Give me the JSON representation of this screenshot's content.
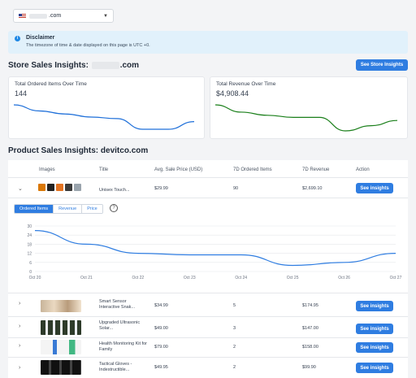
{
  "store_selector": {
    "domain_suffix": ".com",
    "icon": "flag-icon"
  },
  "disclaimer": {
    "title": "Disclaimer",
    "text": "The timezone of time & date displayed on this page is UTC +0."
  },
  "store_insights": {
    "title": "Store Sales Insights:",
    "domain_suffix": ".com",
    "button_label": "See Store Insights",
    "ordered_items": {
      "title": "Total Ordered Items Over Time",
      "value": "144"
    },
    "revenue": {
      "title": "Total Revenue Over Time",
      "value": "$4,908.44"
    }
  },
  "product_insights": {
    "title": "Product Sales Insights: devitco.com",
    "columns": [
      "Images",
      "Title",
      "Avg. Sale Price (USD)",
      "7D Ordered Items",
      "7D Revenue",
      "Action"
    ],
    "rows": [
      {
        "title": "Unisex Touch...",
        "price": "$29.99",
        "ordered": "90",
        "revenue": "$2,699.10",
        "action": "See insights"
      },
      {
        "title": "Smart Sensor Interactive Snak...",
        "price": "$34.99",
        "ordered": "5",
        "revenue": "$174.95",
        "action": "See insights"
      },
      {
        "title": "Upgraded Ultrasonic Solar...",
        "price": "$49.00",
        "ordered": "3",
        "revenue": "$147.00",
        "action": "See insights"
      },
      {
        "title": "Health Monitoring Kit for Family",
        "price": "$79.00",
        "ordered": "2",
        "revenue": "$158.00",
        "action": "See insights"
      },
      {
        "title": "Tactical Gloves - Indestructible...",
        "price": "$49.95",
        "ordered": "2",
        "revenue": "$99.90",
        "action": "See insights"
      }
    ],
    "detail_tabs": [
      "Ordered Items",
      "Revenue",
      "Price"
    ],
    "help_icon": "question-circle-icon"
  },
  "accent_color": "#2f7de1",
  "chart_data": [
    {
      "type": "line",
      "title": "Total Ordered Items Over Time",
      "values": [
        26,
        22,
        20,
        18,
        17,
        10,
        10,
        15
      ],
      "color": "#1e6fd9"
    },
    {
      "type": "line",
      "title": "Total Revenue Over Time",
      "values": [
        800,
        660,
        600,
        560,
        560,
        300,
        400,
        500
      ],
      "color": "#1a7f1a"
    },
    {
      "type": "line",
      "x": [
        "Oct 20",
        "Oct 21",
        "Oct 22",
        "Oct 23",
        "Oct 24",
        "Oct 25",
        "Oct 26",
        "Oct 27"
      ],
      "y": [
        27,
        18,
        12,
        11,
        11,
        4,
        6,
        12
      ],
      "yticks": [
        0,
        6,
        12,
        18,
        24,
        30
      ],
      "ylim": [
        0,
        30
      ],
      "grid": true,
      "color": "#2f7de1"
    }
  ]
}
